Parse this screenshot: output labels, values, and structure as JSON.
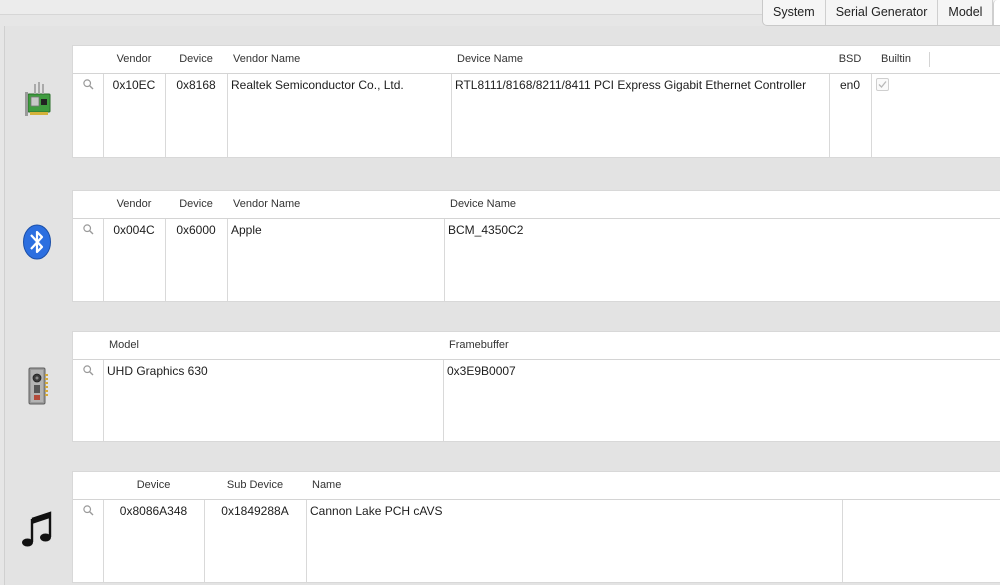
{
  "toolbar": {
    "tabs": [
      {
        "label": "System"
      },
      {
        "label": "Serial Generator"
      },
      {
        "label": "Model"
      }
    ]
  },
  "network": {
    "icon": "network-card-icon",
    "columns": [
      "Vendor",
      "Device",
      "Vendor Name",
      "Device Name",
      "BSD",
      "Builtin"
    ],
    "row": {
      "vendor": "0x10EC",
      "device": "0x8168",
      "vendor_name": "Realtek Semiconductor Co., Ltd.",
      "device_name": "RTL8111/8168/8211/8411 PCI Express Gigabit Ethernet Controller",
      "bsd": "en0",
      "builtin": true
    }
  },
  "bluetooth": {
    "icon": "bluetooth-icon",
    "columns": [
      "Vendor",
      "Device",
      "Vendor Name",
      "Device Name"
    ],
    "row": {
      "vendor": "0x004C",
      "device": "0x6000",
      "vendor_name": "Apple",
      "device_name": "BCM_4350C2"
    }
  },
  "graphics": {
    "icon": "graphics-card-icon",
    "columns": [
      "Model",
      "Framebuffer"
    ],
    "row": {
      "model": "UHD Graphics 630",
      "framebuffer": "0x3E9B0007"
    }
  },
  "audio": {
    "icon": "music-note-icon",
    "columns": [
      "Device",
      "Sub Device",
      "Name"
    ],
    "row": {
      "device": "0x8086A348",
      "sub_device": "0x1849288A",
      "name": "Cannon Lake PCH cAVS"
    }
  },
  "colors": {
    "bluetooth_blue": "#2c6fe0",
    "card_green": "#3f9c3f"
  }
}
